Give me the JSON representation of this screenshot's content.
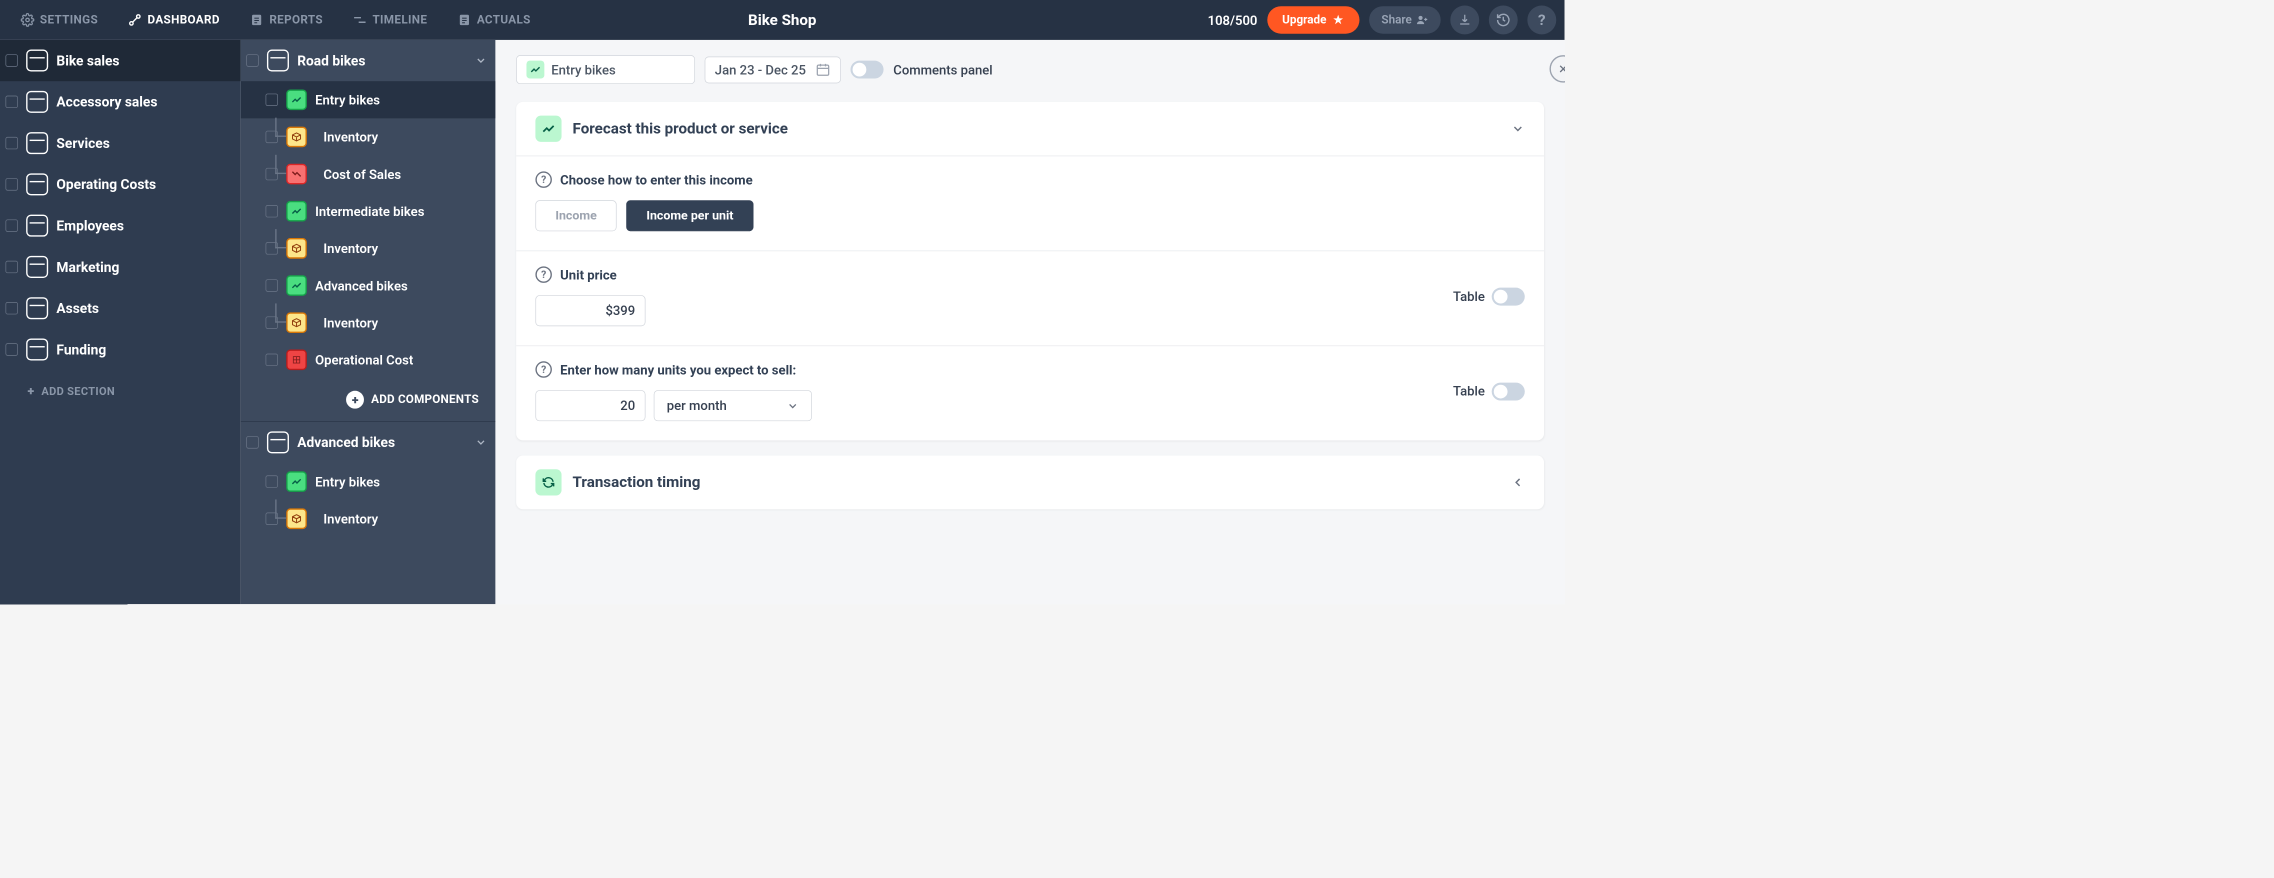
{
  "header": {
    "nav": [
      {
        "label": "SETTINGS",
        "icon": "gear"
      },
      {
        "label": "DASHBOARD",
        "icon": "dashboard",
        "active": true
      },
      {
        "label": "REPORTS",
        "icon": "doc"
      },
      {
        "label": "TIMELINE",
        "icon": "timeline"
      },
      {
        "label": "ACTUALS",
        "icon": "doc"
      }
    ],
    "title": "Bike Shop",
    "quota": "108/500",
    "upgrade": "Upgrade",
    "share": "Share"
  },
  "sidebar_left": {
    "items": [
      {
        "label": "Bike sales",
        "active": true
      },
      {
        "label": "Accessory sales"
      },
      {
        "label": "Services"
      },
      {
        "label": "Operating Costs"
      },
      {
        "label": "Employees"
      },
      {
        "label": "Marketing"
      },
      {
        "label": "Assets"
      },
      {
        "label": "Funding"
      }
    ],
    "add_section": "ADD SECTION"
  },
  "sidebar_mid": {
    "groups": [
      {
        "title": "Road bikes",
        "items": [
          {
            "label": "Entry bikes",
            "color": "green",
            "selected": true
          },
          {
            "label": "Inventory",
            "color": "yellow",
            "sub": true
          },
          {
            "label": "Cost of Sales",
            "color": "red",
            "sub": true
          },
          {
            "label": "Intermediate bikes",
            "color": "green"
          },
          {
            "label": "Inventory",
            "color": "yellow",
            "sub": true
          },
          {
            "label": "Advanced bikes",
            "color": "green"
          },
          {
            "label": "Inventory",
            "color": "yellow",
            "sub": true
          },
          {
            "label": "Operational Cost",
            "color": "red-dark"
          }
        ],
        "add_components": "ADD COMPONENTS"
      },
      {
        "title": "Advanced bikes",
        "items": [
          {
            "label": "Entry bikes",
            "color": "green"
          },
          {
            "label": "Inventory",
            "color": "yellow",
            "sub": true
          }
        ]
      }
    ]
  },
  "main": {
    "breadcrumb": "Entry bikes",
    "date_range": "Jan 23 - Dec 25",
    "comments_label": "Comments panel",
    "forecast": {
      "title": "Forecast this product or service",
      "choose_label": "Choose how to enter this income",
      "option_income": "Income",
      "option_income_per_unit": "Income per unit",
      "unit_price_label": "Unit price",
      "unit_price_value": "$399",
      "table_label": "Table",
      "units_label": "Enter how many units you expect to sell:",
      "units_value": "20",
      "frequency": "per month"
    },
    "timing": {
      "title": "Transaction timing"
    }
  }
}
